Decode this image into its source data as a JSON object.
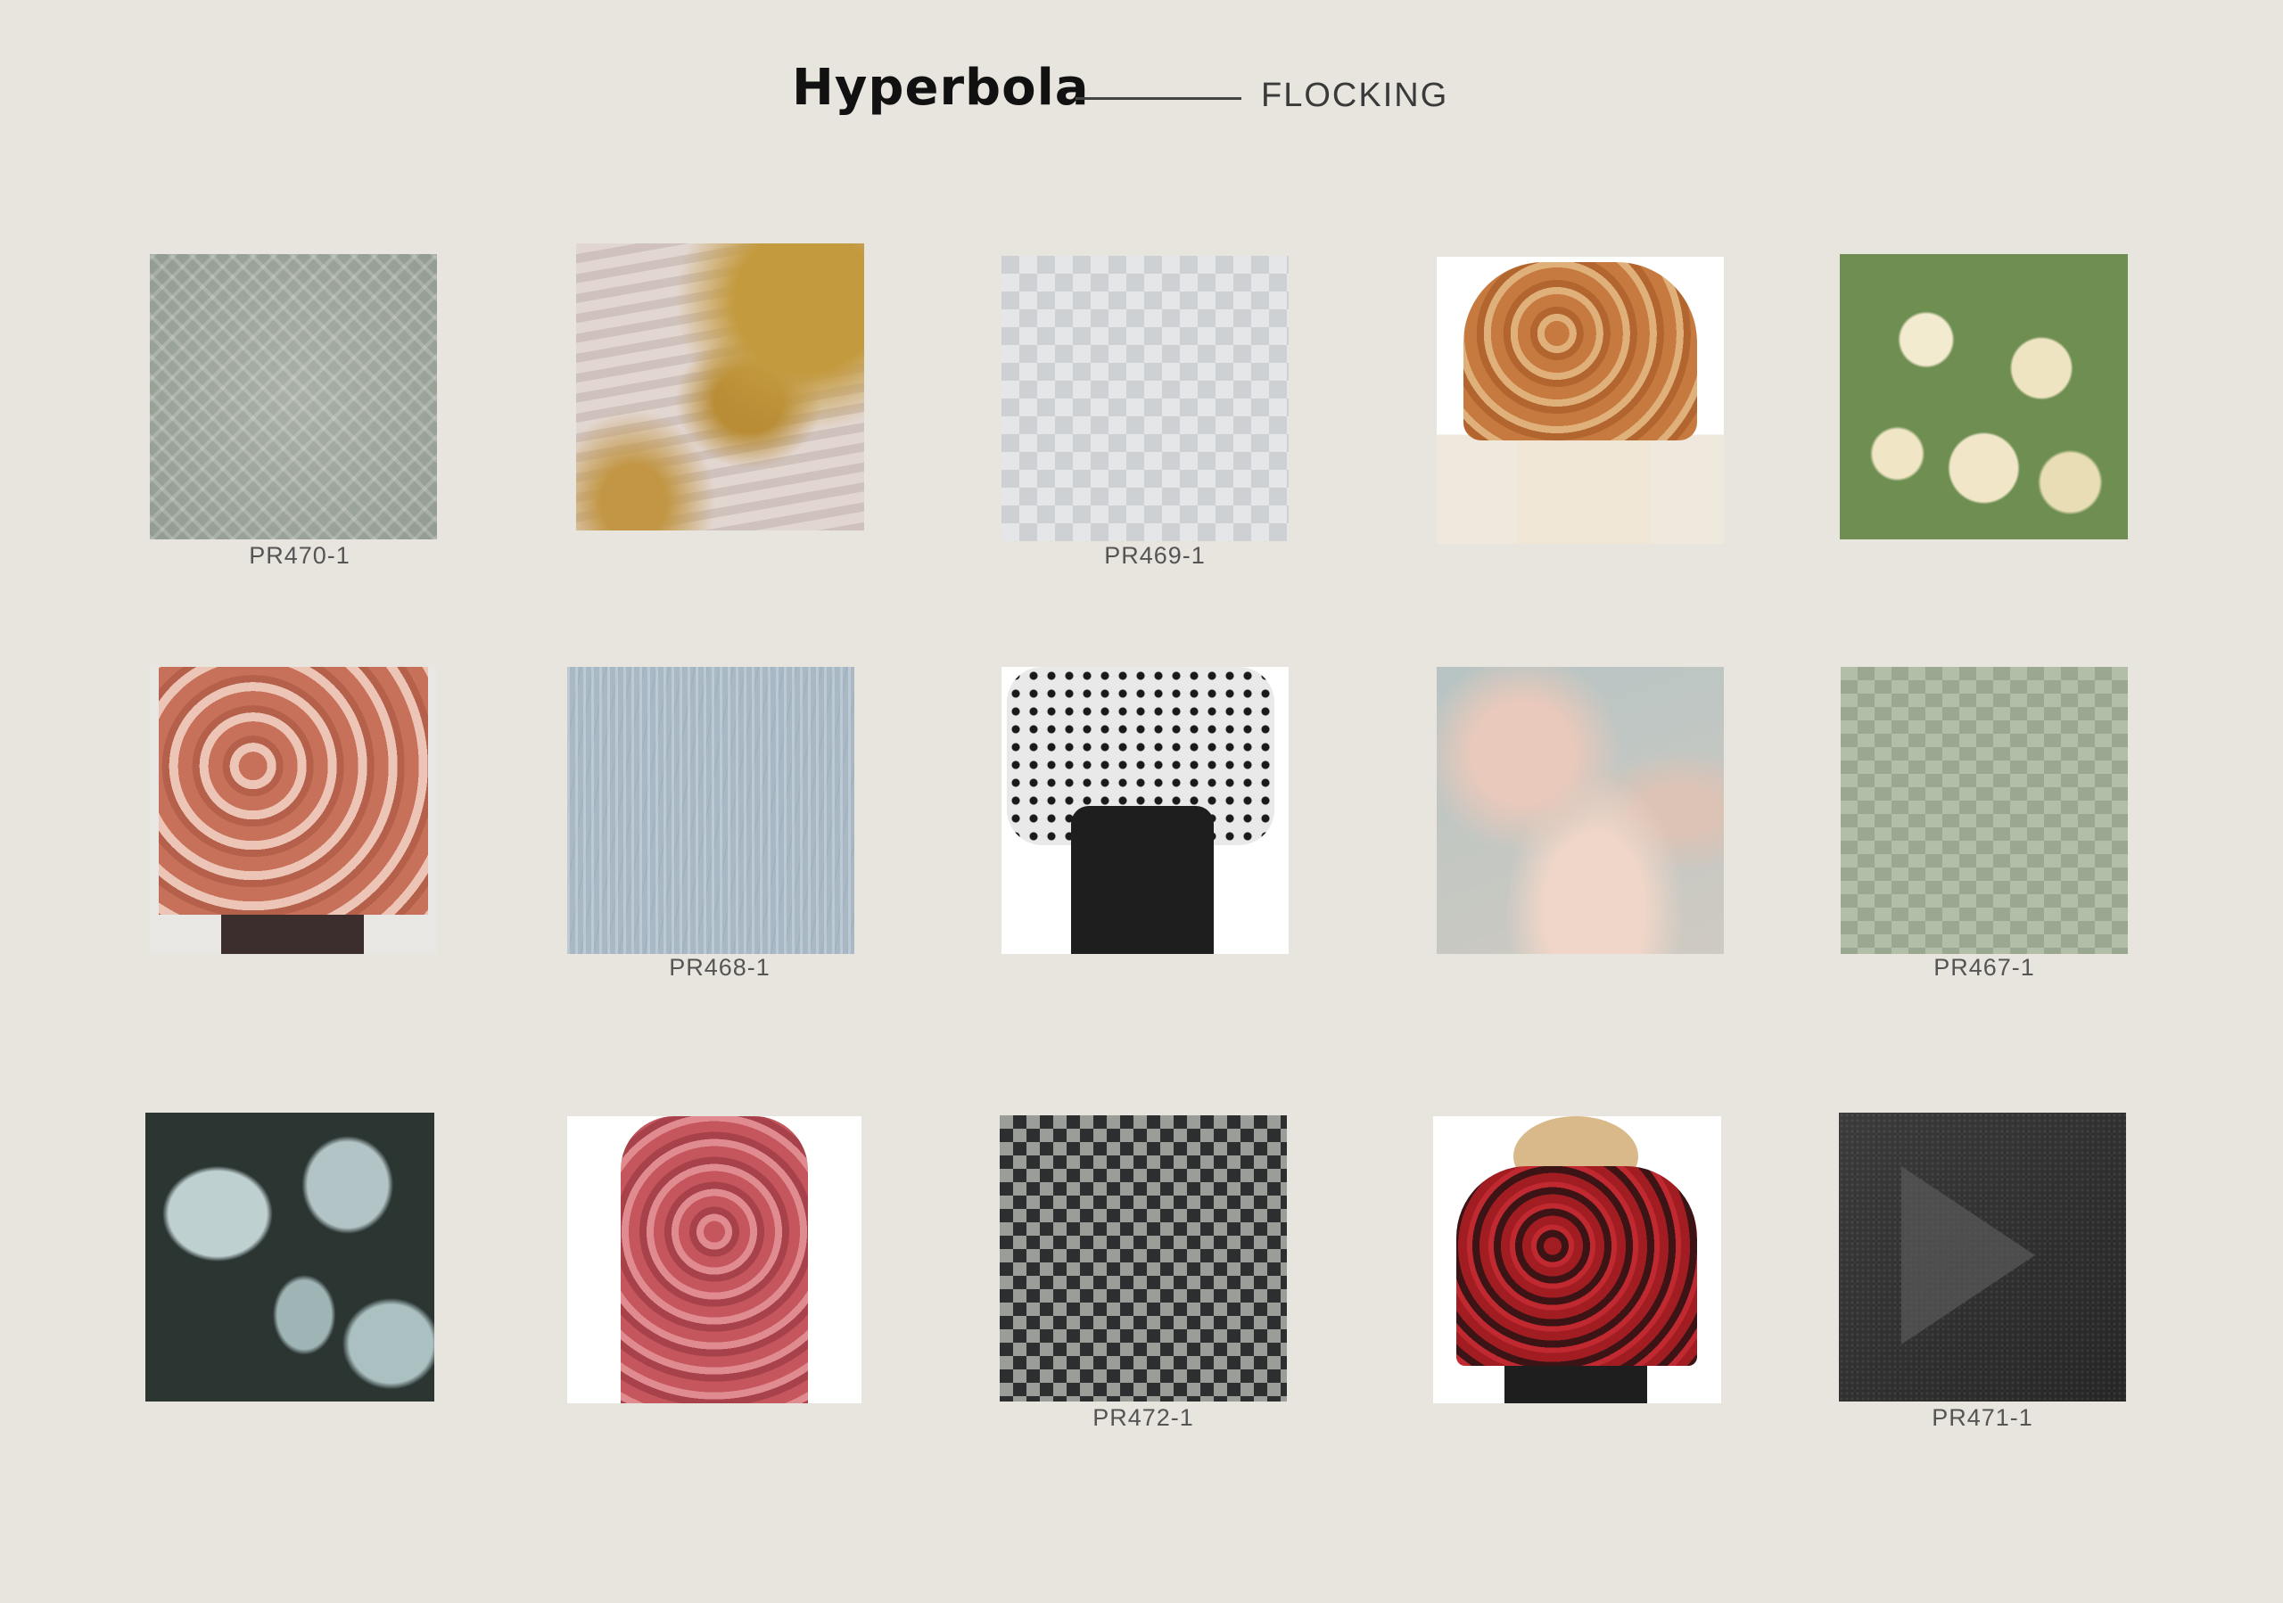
{
  "header": {
    "brand": "Hyperbola",
    "section": "FLOCKING"
  },
  "tiles": [
    {
      "caption": "PR470-1",
      "icon": "gray-diamond-pattern-swatch"
    },
    {
      "caption": "",
      "icon": "gold-leaf-painting-swatch"
    },
    {
      "caption": "PR469-1",
      "icon": "houndstooth-swatch"
    },
    {
      "caption": "",
      "icon": "flocked-velvet-blouse-photo"
    },
    {
      "caption": "",
      "icon": "floral-painting-swatch"
    },
    {
      "caption": "",
      "icon": "velvet-dress-photo"
    },
    {
      "caption": "PR468-1",
      "icon": "blue-distressed-swatch"
    },
    {
      "caption": "",
      "icon": "polka-dot-blouse-photo"
    },
    {
      "caption": "",
      "icon": "cloud-painting-swatch"
    },
    {
      "caption": "PR467-1",
      "icon": "green-square-pattern-swatch"
    },
    {
      "caption": "",
      "icon": "frosted-leaves-photo"
    },
    {
      "caption": "",
      "icon": "red-velvet-halter-photo"
    },
    {
      "caption": "PR472-1",
      "icon": "gingham-check-swatch"
    },
    {
      "caption": "",
      "icon": "red-flocked-top-photo"
    },
    {
      "caption": "PR471-1",
      "icon": "dark-graphic-swatch"
    }
  ],
  "colors": {
    "background": "#e8e5df",
    "text": "#111111",
    "caption": "#555555"
  }
}
